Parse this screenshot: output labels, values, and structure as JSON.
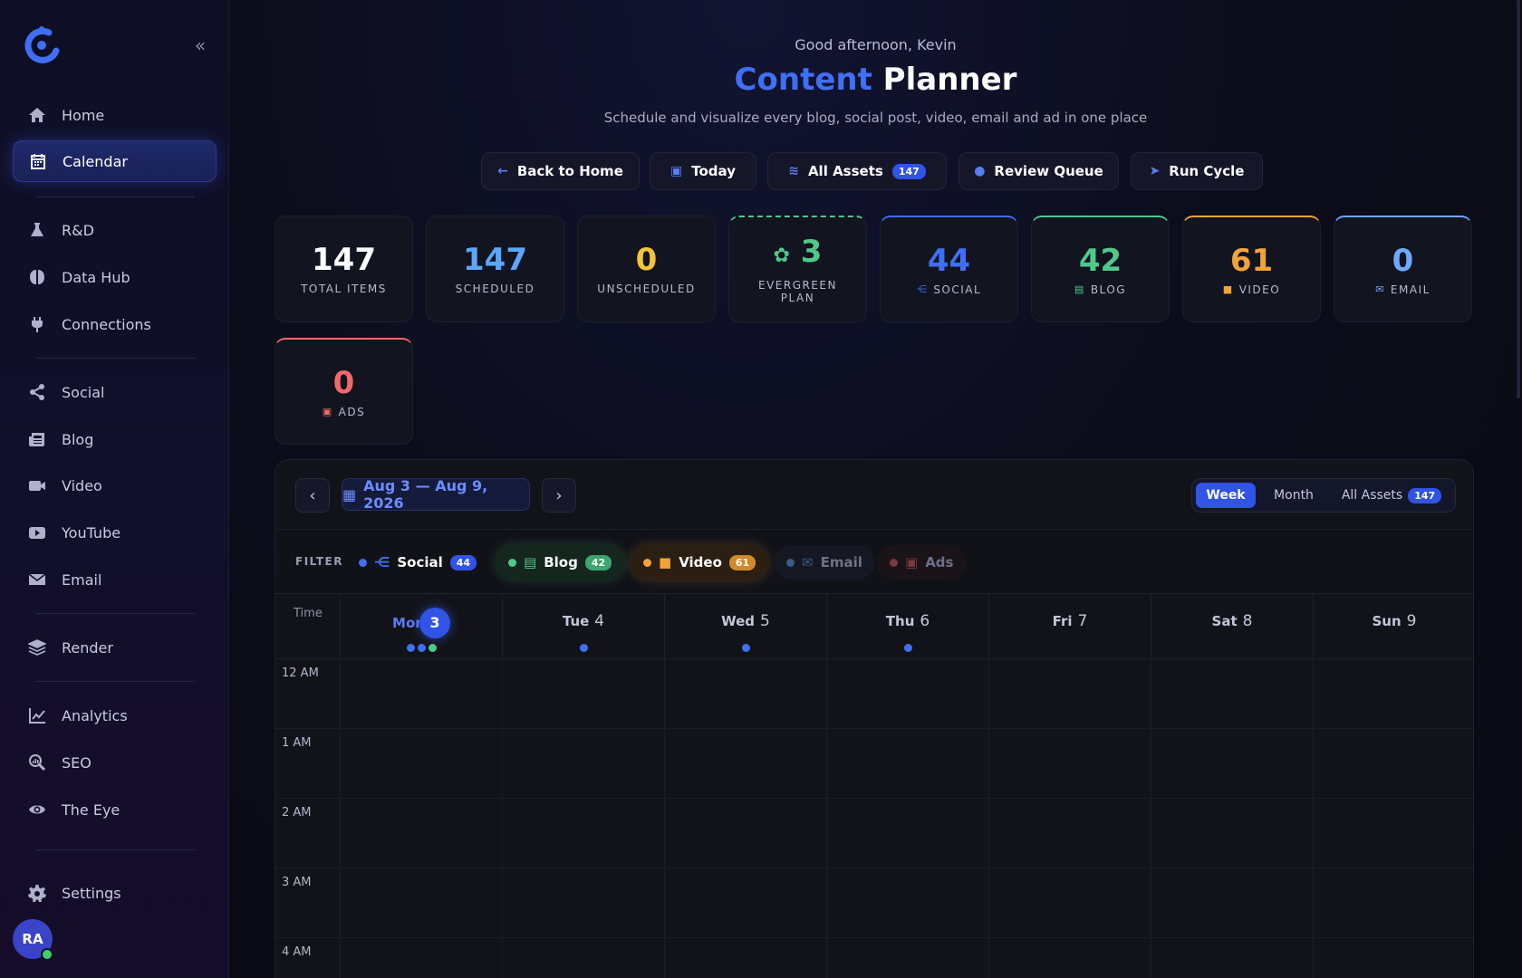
{
  "sidebar": {
    "collapse_icon": "double-chevron-left-icon",
    "items": [
      {
        "label": "Home",
        "icon": "home-icon"
      },
      {
        "label": "Calendar",
        "icon": "calendar-icon",
        "active": true
      },
      {
        "label": "R&D",
        "icon": "flask-icon"
      },
      {
        "label": "Data Hub",
        "icon": "brain-icon"
      },
      {
        "label": "Connections",
        "icon": "plug-icon"
      },
      {
        "label": "Social",
        "icon": "share-icon"
      },
      {
        "label": "Blog",
        "icon": "newspaper-icon"
      },
      {
        "label": "Video",
        "icon": "video-icon"
      },
      {
        "label": "YouTube",
        "icon": "youtube-icon"
      },
      {
        "label": "Email",
        "icon": "mail-icon"
      },
      {
        "label": "Render",
        "icon": "layers-icon"
      },
      {
        "label": "Analytics",
        "icon": "chart-line-icon"
      },
      {
        "label": "SEO",
        "icon": "search-chart-icon"
      },
      {
        "label": "The Eye",
        "icon": "eye-icon"
      },
      {
        "label": "Settings",
        "icon": "gear-icon"
      }
    ],
    "avatar_initials": "RA"
  },
  "header": {
    "greeting": "Good afternoon, Kevin",
    "title_accent": "Content",
    "title_rest": " Planner",
    "subtitle": "Schedule and visualize every blog, social post, video, email and ad in one place"
  },
  "actions": {
    "back": "Back to Home",
    "today": "Today",
    "all_assets": "All Assets",
    "all_assets_count": "147",
    "review": "Review Queue",
    "run": "Run Cycle"
  },
  "stats": {
    "total": {
      "value": "147",
      "label": "TOTAL ITEMS"
    },
    "scheduled": {
      "value": "147",
      "label": "SCHEDULED"
    },
    "unscheduled": {
      "value": "0",
      "label": "UNSCHEDULED"
    },
    "evergreen": {
      "value": "3",
      "label": "EVERGREEN PLAN"
    },
    "social": {
      "value": "44",
      "label": "SOCIAL"
    },
    "blog": {
      "value": "42",
      "label": "BLOG"
    },
    "video": {
      "value": "61",
      "label": "VIDEO"
    },
    "email": {
      "value": "0",
      "label": "EMAIL"
    },
    "ads": {
      "value": "0",
      "label": "ADS"
    }
  },
  "calendar": {
    "range": "Aug 3 — Aug 9, 2026",
    "views": {
      "week": "Week",
      "month": "Month",
      "all": "All Assets",
      "all_count": "147"
    },
    "filter_label": "FILTER",
    "filters": {
      "social": {
        "label": "Social",
        "count": "44"
      },
      "blog": {
        "label": "Blog",
        "count": "42"
      },
      "video": {
        "label": "Video",
        "count": "61"
      },
      "email": {
        "label": "Email"
      },
      "ads": {
        "label": "Ads"
      }
    },
    "time_label": "Time",
    "days": [
      {
        "name": "Mon",
        "num": "3"
      },
      {
        "name": "Tue",
        "num": "4"
      },
      {
        "name": "Wed",
        "num": "5"
      },
      {
        "name": "Thu",
        "num": "6"
      },
      {
        "name": "Fri",
        "num": "7"
      },
      {
        "name": "Sat",
        "num": "8"
      },
      {
        "name": "Sun",
        "num": "9"
      }
    ],
    "hours": [
      "12 AM",
      "1 AM",
      "2 AM",
      "3 AM",
      "4 AM"
    ]
  },
  "colors": {
    "accent": "#2f54e6",
    "social": "#3f6ff5",
    "blog": "#4fc98a",
    "video": "#f2a33a",
    "email": "#6fa8ff",
    "ads": "#f06a6a"
  }
}
